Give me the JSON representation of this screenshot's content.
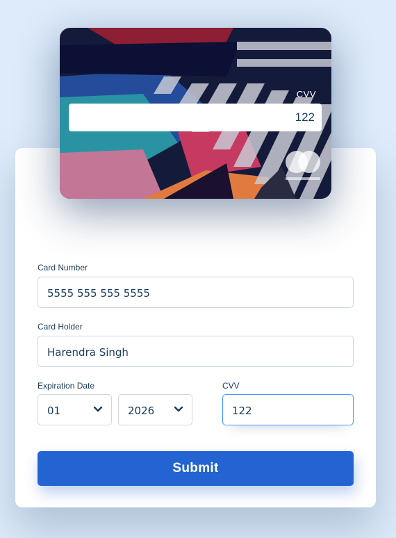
{
  "card": {
    "cvv_label": "CVV",
    "cvv_value": "122",
    "brand": "mastercard"
  },
  "form": {
    "card_number": {
      "label": "Card Number",
      "value": "5555 555 555 5555"
    },
    "card_holder": {
      "label": "Card Holder",
      "value": "Harendra Singh"
    },
    "expiration": {
      "label": "Expiration Date",
      "month": "01",
      "year": "2026"
    },
    "cvv": {
      "label": "CVV",
      "value": "122"
    },
    "submit_label": "Submit"
  },
  "colors": {
    "background": "#ddebfa",
    "accent": "#2364d2",
    "text": "#1a3b5d",
    "focus_border": "#3d9cff"
  },
  "icons": {
    "select_chevron": "chevron-down-icon",
    "card_brand": "mastercard-logo"
  }
}
